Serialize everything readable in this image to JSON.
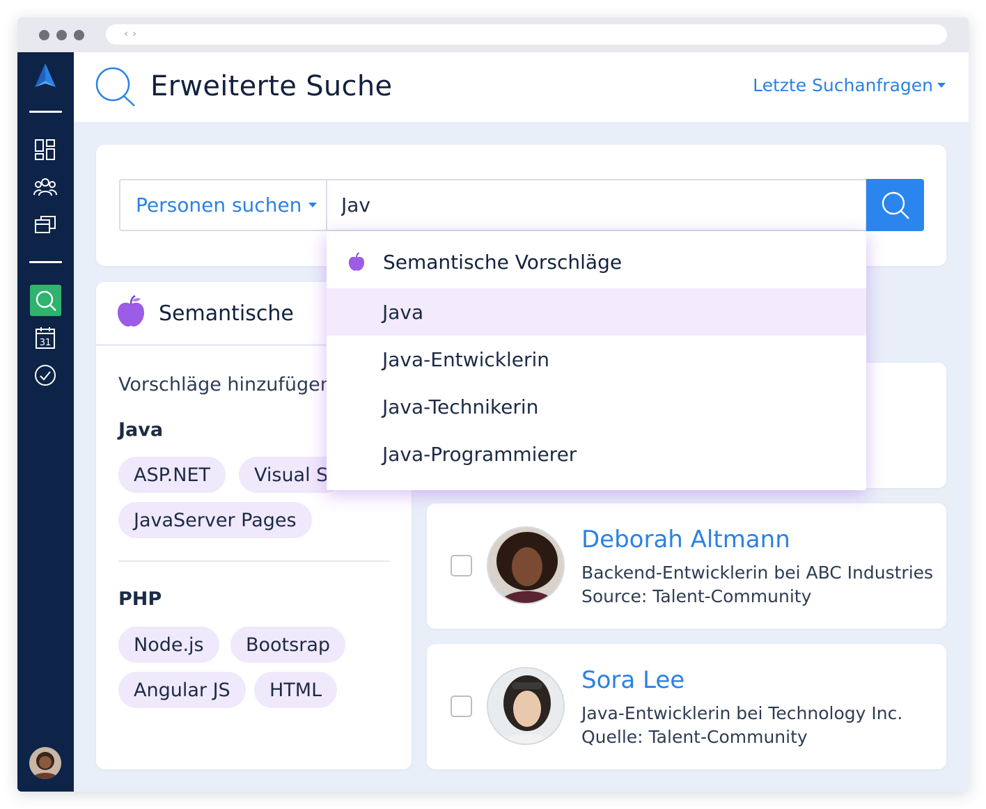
{
  "app": {
    "page_title": "Erweiterte Suche",
    "recent_searches_label": "Letzte Suchanfragen"
  },
  "search": {
    "type_label": "Personen suchen",
    "query": "Jav"
  },
  "suggestions_dropdown": {
    "header": "Semantische Vorschläge",
    "items": [
      "Java",
      "Java-Entwicklerin",
      "Java-Technikerin",
      "Java-Programmierer"
    ],
    "highlighted_index": 0
  },
  "semantic_panel": {
    "title": "Semantische",
    "add_label": "Vorschläge hinzufügen",
    "groups": [
      {
        "name": "Java",
        "chips": [
          "ASP.NET",
          "Visual S",
          "JavaServer Pages"
        ]
      },
      {
        "name": "PHP",
        "chips": [
          "Node.js",
          "Bootsrap",
          "Angular JS",
          "HTML"
        ]
      }
    ]
  },
  "results": [
    {
      "name": "Deborah Altmann",
      "title": "Backend-Entwicklerin bei ABC Industries",
      "source": "Source: Talent-Community"
    },
    {
      "name": "Sora Lee",
      "title": "Java-Entwicklerin bei Technology Inc.",
      "source": "Quelle: Talent-Community"
    }
  ],
  "sidebar": {
    "icons": [
      "logo-icon",
      "dashboard-icon",
      "people-icon",
      "jobs-icon",
      "search-icon",
      "calendar-icon",
      "check-icon"
    ],
    "calendar_day": "31"
  },
  "colors": {
    "sidebar_bg": "#0d2347",
    "accent_blue": "#2a82e4",
    "active_green": "#2fb36f",
    "chip_purple": "#f0e8fb",
    "semantic_purple": "#9c5ce6"
  }
}
